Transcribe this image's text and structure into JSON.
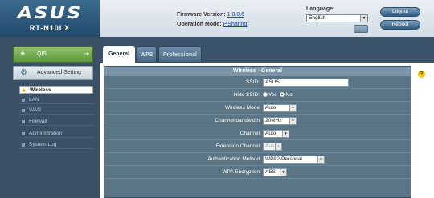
{
  "header": {
    "brand": "ASUS",
    "model": "RT-N10LX",
    "firmware_label": "Firmware Version:",
    "firmware_value": "1.0.0.6",
    "opmode_label": "Operation Mode:",
    "opmode_value": "P.Sharing",
    "language_label": "Language:",
    "language_value": "English",
    "logout_label": "Logout",
    "reboot_label": "Reboot"
  },
  "sidebar": {
    "qis_label": "QIS",
    "advanced_label": "Advanced Setting",
    "items": [
      {
        "label": "Wireless"
      },
      {
        "label": "LAN"
      },
      {
        "label": "WAN"
      },
      {
        "label": "Firewall"
      },
      {
        "label": "Administration"
      },
      {
        "label": "System Log"
      }
    ]
  },
  "tabs": [
    {
      "label": "General"
    },
    {
      "label": "WPS"
    },
    {
      "label": "Professional"
    }
  ],
  "panel": {
    "title": "Wireless - General",
    "help_icon": "?",
    "rows": [
      {
        "label": "SSID:",
        "value": "ASUS"
      },
      {
        "label": "Hide SSID:",
        "opt_yes": "Yes",
        "opt_no": "No",
        "selected": "No"
      },
      {
        "label": "Wireless Mode",
        "value": "Auto"
      },
      {
        "label": "Channel bandwidth",
        "value": "20MHz"
      },
      {
        "label": "Channel",
        "value": "Auto"
      },
      {
        "label": "Extension Channel",
        "value": "Auto"
      },
      {
        "label": "Authentication Method",
        "value": "WPA2-Personal"
      },
      {
        "label": "WPA Encryption",
        "value": "AES"
      }
    ]
  },
  "colors": {
    "sidebar_bg": "#3b5064",
    "panel_bg": "#5b7486",
    "qis_green": "#5c9a3d",
    "help_yellow": "#f2c200"
  },
  "icons": {
    "qis": "wand-icon",
    "advanced": "wrench-icon",
    "help": "help-icon"
  }
}
